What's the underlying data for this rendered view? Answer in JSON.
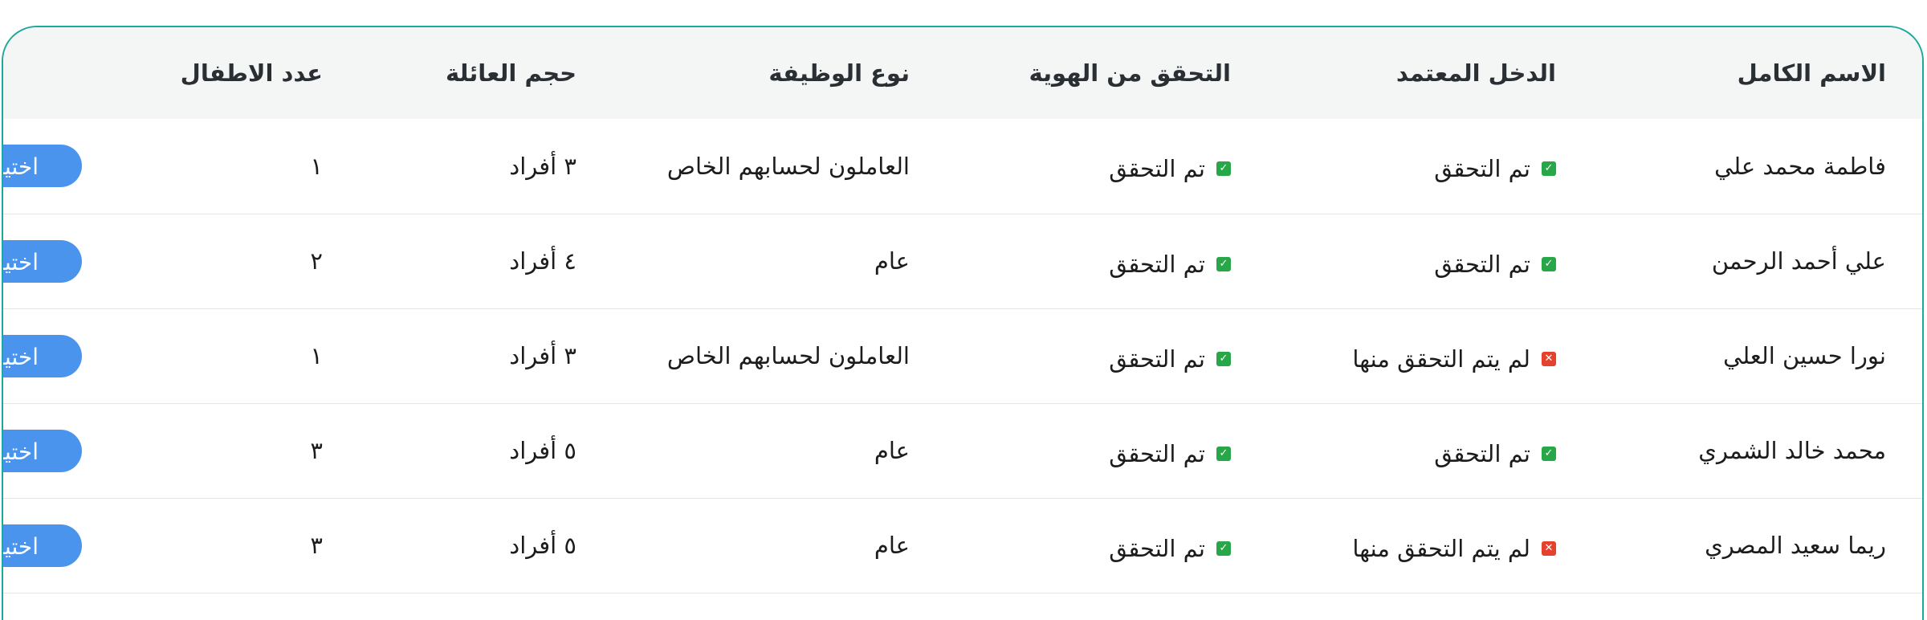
{
  "table": {
    "headers": [
      "الاسم الكامل",
      "الدخل المعتمد",
      "التحقق من الهوية",
      "نوع الوظيفة",
      "حجم العائلة",
      "عدد الاطفال",
      ""
    ],
    "select_label": "اختيار",
    "rows": [
      {
        "name": "فاطمة محمد علي",
        "income": "تم التحقق",
        "income_ok": true,
        "identity": "تم التحقق",
        "identity_ok": true,
        "job": "العاملون لحسابهم الخاص",
        "family": "٣ أفراد",
        "children": "١"
      },
      {
        "name": "علي أحمد الرحمن",
        "income": "تم التحقق",
        "income_ok": true,
        "identity": "تم التحقق",
        "identity_ok": true,
        "job": "عام",
        "family": "٤ أفراد",
        "children": "٢"
      },
      {
        "name": "نورا حسين العلي",
        "income": "لم يتم التحقق منها",
        "income_ok": false,
        "identity": "تم التحقق",
        "identity_ok": true,
        "job": "العاملون لحسابهم الخاص",
        "family": "٣ أفراد",
        "children": "١"
      },
      {
        "name": "محمد خالد الشمري",
        "income": "تم التحقق",
        "income_ok": true,
        "identity": "تم التحقق",
        "identity_ok": true,
        "job": "عام",
        "family": "٥ أفراد",
        "children": "٣"
      },
      {
        "name": "ريما سعيد المصري",
        "income": "لم يتم التحقق منها",
        "income_ok": false,
        "identity": "تم التحقق",
        "identity_ok": true,
        "job": "عام",
        "family": "٥ أفراد",
        "children": "٣"
      }
    ]
  },
  "colors": {
    "border_accent": "#1aa99c",
    "verified": "#27a748",
    "unverified": "#e5412c",
    "button": "#4b94ee",
    "header_bg": "#f4f6f5"
  },
  "icons": {
    "verified": "check-icon",
    "unverified": "x-icon"
  }
}
